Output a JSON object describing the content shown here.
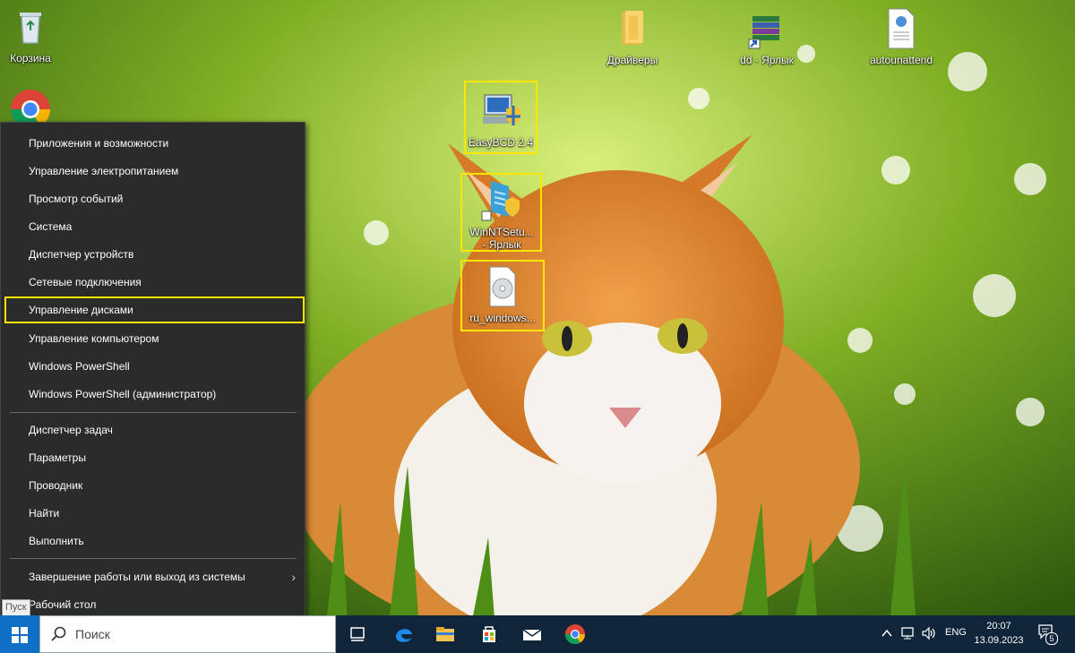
{
  "desktop": {
    "icons": {
      "recycle_bin": "Корзина",
      "drivers": "Драйверы",
      "dd_shortcut": "dd - Ярлык",
      "autounattend": "autounattend",
      "easybcd": "EasyBCD 2.4",
      "winntsetup_line1": "WinNTSetu...",
      "winntsetup_line2": "- Ярлык",
      "iso": "ru_windows..."
    },
    "highlight_color": "#ffe600"
  },
  "menu": {
    "items": [
      {
        "label": "Приложения и возможности"
      },
      {
        "label": "Управление электропитанием"
      },
      {
        "label": "Просмотр событий"
      },
      {
        "label": "Система"
      },
      {
        "label": "Диспетчер устройств"
      },
      {
        "label": "Сетевые подключения"
      },
      {
        "label": "Управление дисками"
      },
      {
        "label": "Управление компьютером"
      },
      {
        "label": "Windows PowerShell"
      },
      {
        "label": "Windows PowerShell (администратор)"
      },
      {
        "label": "Диспетчер задач"
      },
      {
        "label": "Параметры"
      },
      {
        "label": "Проводник"
      },
      {
        "label": "Найти"
      },
      {
        "label": "Выполнить"
      },
      {
        "label": "Завершение работы или выход из системы"
      },
      {
        "label": "Рабочий стол"
      }
    ],
    "submenu_arrow": "›"
  },
  "start_tooltip": "Пуск",
  "taskbar": {
    "search_placeholder": "Поиск",
    "icons": [
      "task-view-icon",
      "edge-icon",
      "file-explorer-icon",
      "store-icon",
      "mail-icon",
      "chrome-icon"
    ],
    "tray": {
      "language": "ENG",
      "time": "20:07",
      "date": "13.09.2023",
      "notifications_count": "5"
    },
    "accent": "#0f6fc6"
  }
}
